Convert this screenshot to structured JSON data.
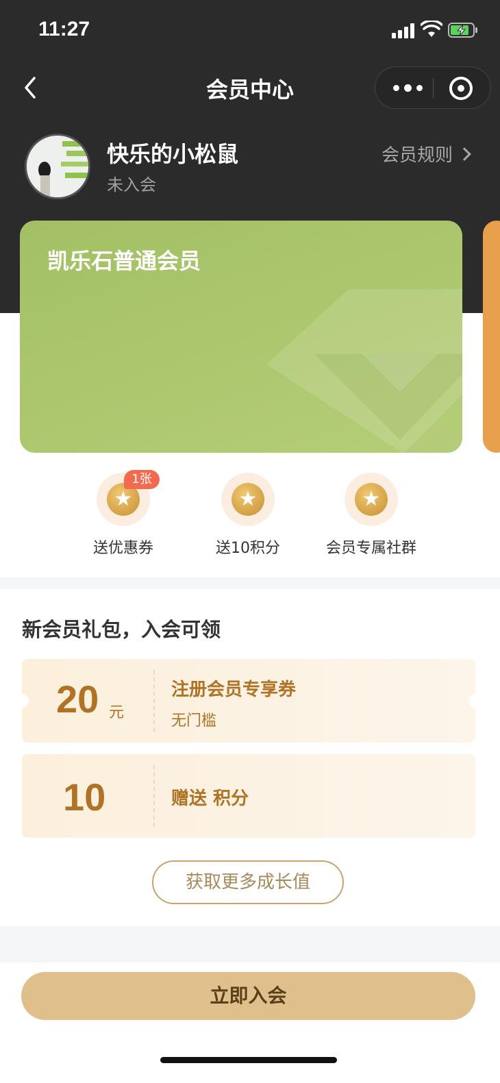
{
  "status_bar": {
    "time": "11:27"
  },
  "nav": {
    "title": "会员中心"
  },
  "user": {
    "name": "快乐的小松鼠",
    "status": "未入会",
    "rules_link": "会员规则"
  },
  "card": {
    "level_name": "凯乐石普通会员",
    "color": "#a3c064"
  },
  "benefits": [
    {
      "label": "送优惠券",
      "badge": "1张",
      "icon": "star-coin-icon"
    },
    {
      "label": "送10积分",
      "icon": "star-coin-icon"
    },
    {
      "label": "会员专属社群",
      "icon": "star-coin-icon"
    }
  ],
  "gift": {
    "title": "新会员礼包，入会可领",
    "coupons": [
      {
        "amount": "20",
        "unit": "元",
        "title": "注册会员专享券",
        "subtitle": "无门槛"
      },
      {
        "amount": "10",
        "title": "赠送 积分"
      }
    ],
    "more_button": "获取更多成长值"
  },
  "footer": {
    "join_button": "立即入会"
  },
  "colors": {
    "accent": "#dfc08b",
    "coupon_text": "#b07326",
    "header_bg": "#2b2b2b"
  }
}
